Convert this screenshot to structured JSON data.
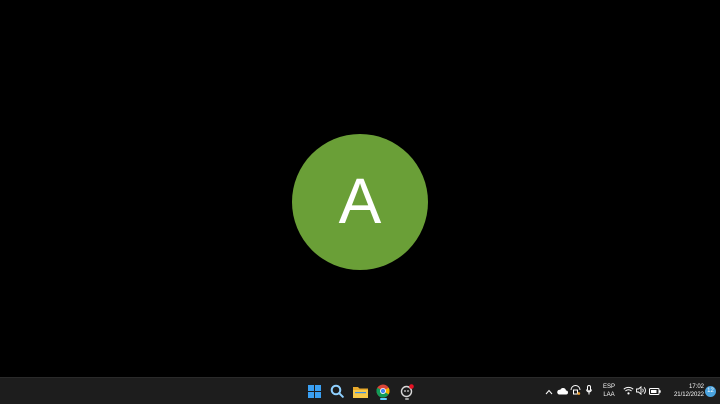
{
  "desktop": {
    "avatar_initial": "A",
    "avatar_color": "#6a9f37",
    "background_color": "#000000"
  },
  "taskbar": {
    "background_color": "#1d1d1d",
    "pinned": [
      {
        "name": "start",
        "icon": "windows-logo-icon"
      },
      {
        "name": "search",
        "icon": "search-icon"
      },
      {
        "name": "file-explorer",
        "icon": "folder-icon"
      },
      {
        "name": "chrome",
        "icon": "chrome-icon",
        "active": true
      },
      {
        "name": "app",
        "icon": "notification-app-icon"
      }
    ],
    "tray": {
      "icons": [
        "chevron-up-icon",
        "cloud-icon",
        "vpn-icon",
        "microphone-icon",
        "wifi-icon",
        "volume-icon",
        "battery-icon"
      ],
      "language_line1": "ESP",
      "language_line2": "LAA",
      "time": "17:02",
      "date": "21/12/2022",
      "notification_count": "12"
    }
  }
}
